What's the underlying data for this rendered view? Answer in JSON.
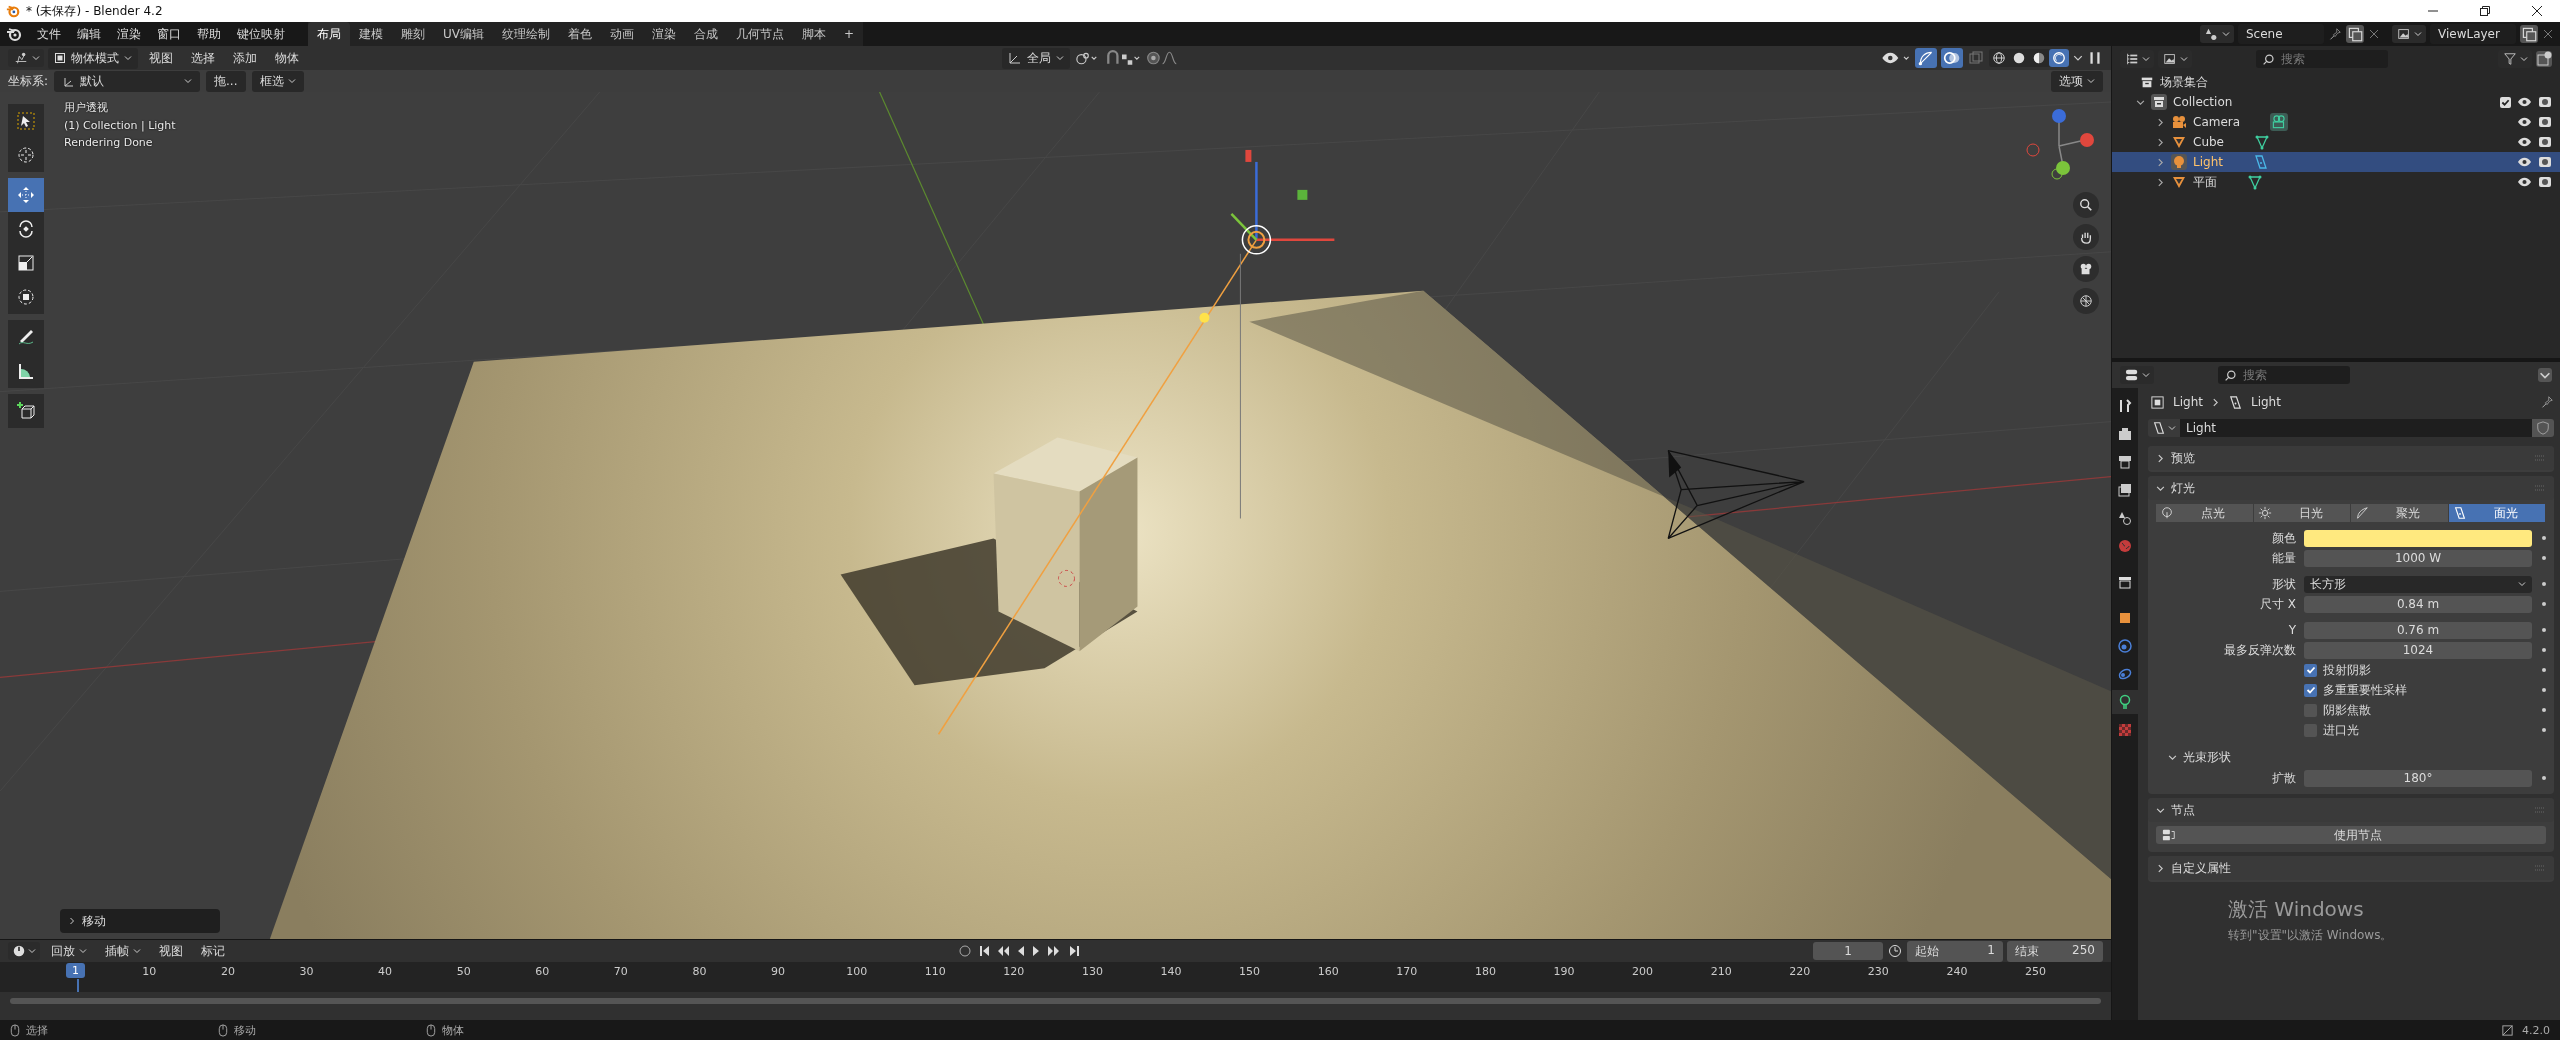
{
  "window": {
    "title": "* (未保存) - Blender 4.2"
  },
  "menu": [
    "文件",
    "编辑",
    "渲染",
    "窗口",
    "帮助",
    "键位映射"
  ],
  "workspaces": [
    {
      "label": "布局",
      "selected": true
    },
    {
      "label": "建模",
      "selected": false
    },
    {
      "label": "雕刻",
      "selected": false
    },
    {
      "label": "UV编辑",
      "selected": false
    },
    {
      "label": "纹理绘制",
      "selected": false
    },
    {
      "label": "着色",
      "selected": false
    },
    {
      "label": "动画",
      "selected": false
    },
    {
      "label": "渲染",
      "selected": false
    },
    {
      "label": "合成",
      "selected": false
    },
    {
      "label": "几何节点",
      "selected": false
    },
    {
      "label": "脚本",
      "selected": false
    }
  ],
  "add_workspace": "+",
  "scene": "Scene",
  "view_layer": "ViewLayer",
  "header": {
    "mode": "物体模式",
    "menus": [
      "视图",
      "选择",
      "添加",
      "物体"
    ],
    "orientation": "全局",
    "shading_modes": [
      {
        "kind": "wireframe",
        "selected": false
      },
      {
        "kind": "solid",
        "selected": false
      },
      {
        "kind": "material",
        "selected": false
      },
      {
        "kind": "rendered",
        "selected": true
      }
    ]
  },
  "tool_settings": {
    "coord_label": "坐标系:",
    "coord_value": "默认",
    "drag": "拖...",
    "select": "框选",
    "options": "选项"
  },
  "viewport": {
    "overlay_lines": [
      "用户透视",
      "(1) Collection | Light",
      "Rendering Done"
    ],
    "last_operation": "移动",
    "tools": [
      {
        "kind": "select",
        "selected": false
      },
      {
        "kind": "cursor",
        "selected": false
      },
      {
        "kind": "move",
        "selected": true
      },
      {
        "kind": "rotate",
        "selected": false
      },
      {
        "kind": "scale",
        "selected": false
      },
      {
        "kind": "transform",
        "selected": false
      },
      {
        "kind": "annotate",
        "selected": false
      },
      {
        "kind": "measure",
        "selected": false
      },
      {
        "kind": "add_cube",
        "selected": false
      }
    ]
  },
  "outliner": {
    "search_placeholder": "搜索",
    "root": "场景集合",
    "collections": [
      {
        "name": "Collection",
        "checked": true,
        "expanded": true,
        "children": [
          {
            "name": "Camera",
            "kind": "camera",
            "selected": false
          },
          {
            "name": "Cube",
            "kind": "mesh",
            "selected": false
          },
          {
            "name": "Light",
            "kind": "light",
            "selected": true
          },
          {
            "name": "平面",
            "kind": "mesh",
            "selected": false
          }
        ]
      }
    ]
  },
  "properties": {
    "search_placeholder": "搜索",
    "tabs": [
      {
        "kind": "tool",
        "selected": false
      },
      {
        "kind": "render",
        "selected": false
      },
      {
        "kind": "output",
        "selected": false
      },
      {
        "kind": "view_layer",
        "selected": false
      },
      {
        "kind": "scene",
        "selected": false
      },
      {
        "kind": "world",
        "selected": false
      },
      {
        "kind": "collection",
        "selected": false
      },
      {
        "kind": "object",
        "selected": false
      },
      {
        "kind": "physics",
        "selected": false
      },
      {
        "kind": "constraints",
        "selected": false
      },
      {
        "kind": "light_data",
        "selected": true
      },
      {
        "kind": "texture",
        "selected": false
      }
    ],
    "breadcrumb": [
      "Light",
      "Light"
    ],
    "datablock": "Light",
    "preview": {
      "title": "预览",
      "expanded": false
    },
    "light": {
      "title": "灯光",
      "expanded": true,
      "types": [
        {
          "label": "点光",
          "kind": "point",
          "selected": false
        },
        {
          "label": "日光",
          "kind": "sun",
          "selected": false
        },
        {
          "label": "聚光",
          "kind": "spot",
          "selected": false
        },
        {
          "label": "面光",
          "kind": "area",
          "selected": true
        }
      ],
      "rows": [
        {
          "kind": "color",
          "label": "颜色",
          "color": "#ffe97f"
        },
        {
          "kind": "number",
          "label": "能量",
          "value": "1000 W"
        },
        {
          "kind": "dropdown",
          "label": "形状",
          "value": "长方形"
        },
        {
          "kind": "number",
          "label": "尺寸 X",
          "value": "0.84 m"
        },
        {
          "kind": "number",
          "label": "Y",
          "value": "0.76 m"
        },
        {
          "kind": "number",
          "label": "最多反弹次数",
          "value": "1024"
        },
        {
          "kind": "checkbox",
          "label": "投射阴影",
          "checked": true
        },
        {
          "kind": "checkbox",
          "label": "多重重要性采样",
          "checked": true
        },
        {
          "kind": "checkbox",
          "label": "阴影焦散",
          "checked": false
        },
        {
          "kind": "checkbox",
          "label": "进口光",
          "checked": false
        }
      ],
      "beam": {
        "title": "光束形状",
        "expanded": true,
        "label": "扩散",
        "value": "180°"
      }
    },
    "nodes": {
      "title": "节点",
      "expanded": true,
      "button": "使用节点"
    },
    "custom": {
      "title": "自定义属性",
      "expanded": false
    }
  },
  "timeline": {
    "menus": [
      "回放",
      "插帧",
      "视图",
      "标记"
    ],
    "current_frame": "1",
    "start_label": "起始",
    "start": "1",
    "end_label": "结束",
    "end": "250",
    "playhead": "1",
    "ruler": [
      "10",
      "20",
      "30",
      "40",
      "50",
      "60",
      "70",
      "80",
      "90",
      "100",
      "110",
      "120",
      "130",
      "140",
      "150",
      "160",
      "170",
      "180",
      "190",
      "200",
      "210",
      "220",
      "230",
      "240",
      "250"
    ]
  },
  "status_bar": {
    "items": [
      "选择",
      "移动",
      "物体"
    ],
    "version": "4.2.0"
  },
  "activation_notice": {
    "title": "激活 Windows",
    "text": "转到\"设置\"以激活 Windows。"
  }
}
